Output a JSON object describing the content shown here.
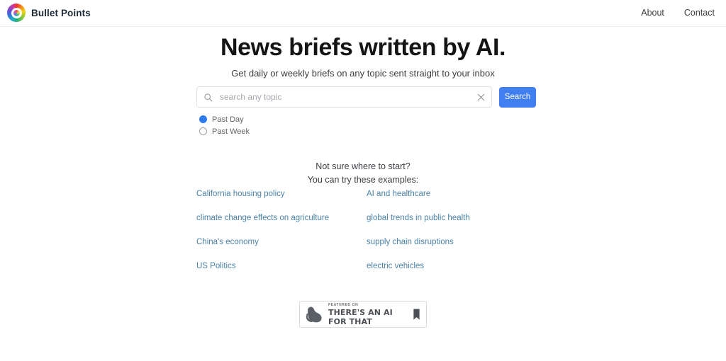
{
  "header": {
    "brand": {
      "name": "Bullet Points",
      "logo_icon": "rainbow-circle-logo"
    },
    "nav": [
      {
        "label": "About"
      },
      {
        "label": "Contact"
      }
    ]
  },
  "hero": {
    "title": "News briefs written by AI.",
    "subtitle": "Get daily or weekly briefs on any topic sent straight to your inbox"
  },
  "search": {
    "icon": "search-icon",
    "placeholder": "search any topic",
    "value": "",
    "clear_icon": "close-icon",
    "button_label": "Search",
    "accent_color": "#3f7ff1"
  },
  "timeframe": {
    "options": [
      {
        "label": "Past Day",
        "selected": true
      },
      {
        "label": "Past Week",
        "selected": false
      }
    ]
  },
  "examples": {
    "heading_line1": "Not sure where to start?",
    "heading_line2": "You can try these examples:",
    "link_color": "#4a82a8",
    "items": [
      {
        "label": "California housing policy"
      },
      {
        "label": "AI and healthcare"
      },
      {
        "label": "climate change effects on agriculture"
      },
      {
        "label": "global trends in public health"
      },
      {
        "label": "China's economy"
      },
      {
        "label": "supply chain disruptions"
      },
      {
        "label": "US Politics"
      },
      {
        "label": "electric vehicles"
      }
    ]
  },
  "badge": {
    "arm_icon": "flexed-bicep-icon",
    "kicker": "FEATURED ON",
    "title": "THERE'S AN AI FOR THAT",
    "bookmark_icon": "bookmark-icon"
  }
}
